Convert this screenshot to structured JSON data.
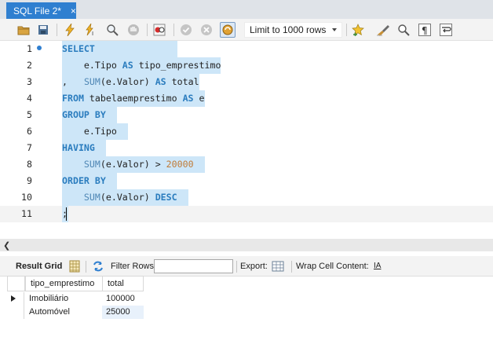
{
  "tab": {
    "title": "SQL File 2*",
    "close": "×"
  },
  "toolbar": {
    "limit_value": "Limit to 1000 rows"
  },
  "editor": {
    "lines": [
      {
        "num": "1"
      },
      {
        "num": "2"
      },
      {
        "num": "3"
      },
      {
        "num": "4"
      },
      {
        "num": "5"
      },
      {
        "num": "6"
      },
      {
        "num": "7"
      },
      {
        "num": "8"
      },
      {
        "num": "9"
      },
      {
        "num": "10"
      },
      {
        "num": "11"
      }
    ],
    "tokens": {
      "select": "SELECT",
      "e_tipo": "e.Tipo",
      "as": "AS",
      "alias1": "tipo_emprestimo",
      "comma": ",",
      "sum": "SUM",
      "e_valor_paren": "(e.Valor)",
      "alias2": "total",
      "from": "FROM",
      "table": "tabelaemprestimo",
      "alias_e": "e",
      "group_by": "GROUP BY",
      "having": "HAVING",
      "gt": ">",
      "threshold": "20000",
      "order_by": "ORDER BY",
      "desc": "DESC",
      "semicolon": ";"
    }
  },
  "results": {
    "result_grid_label": "Result Grid",
    "filter_label": "Filter Rows:",
    "filter_value": "",
    "export_label": "Export:",
    "wrap_label": "Wrap Cell Content:",
    "wrap_icon_glyph": "IA",
    "columns": [
      "tipo_emprestimo",
      "total"
    ],
    "rows": [
      [
        "Imobiliário",
        "100000"
      ],
      [
        "Automóvel",
        "25000"
      ]
    ]
  },
  "colors": {
    "tab_active": "#2f7fd0",
    "selection": "#cde6f8",
    "keyword": "#2a7cbe",
    "number": "#c07a36"
  }
}
